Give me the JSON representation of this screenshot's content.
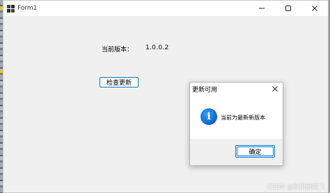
{
  "window": {
    "title": "Form1",
    "icon": "app-window-icon",
    "controls": [
      "minimize-icon",
      "maximize-icon",
      "close-icon"
    ]
  },
  "main": {
    "version_label": "当前版本：",
    "version_value": "1.0.0.2",
    "check_button_label": "检查更新"
  },
  "dialog": {
    "title": "更新可用",
    "icon": "info-icon",
    "icon_glyph": "i",
    "message": "当前为最新新版本",
    "ok_label": "确定"
  },
  "watermark": "CSDN @秋雨雁南飞",
  "colors": {
    "accent": "#0078d4",
    "window_bg": "#f0f0f0",
    "titlebar_bg": "#ffffff",
    "info_icon": "#0a63c9"
  }
}
